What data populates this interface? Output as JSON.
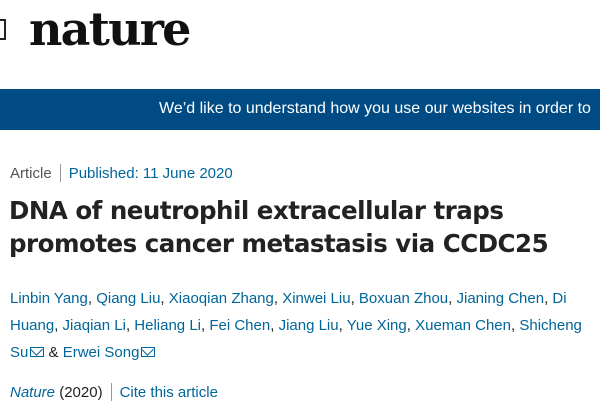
{
  "header": {
    "logo_text": "nature"
  },
  "banner": {
    "text": "We’d like to understand how you use our websites in order to"
  },
  "article": {
    "type": "Article",
    "published": "Published: 11 June 2020",
    "title": "DNA of neutrophil extracellular traps promotes cancer metastasis via CCDC25",
    "authors": [
      "Linbin Yang",
      "Qiang Liu",
      "Xiaoqian Zhang",
      "Xinwei Liu",
      "Boxuan Zhou",
      "Jianing Chen",
      "Di Huang",
      "Jiaqian Li",
      "Heliang Li",
      "Fei Chen",
      "Jiang Liu",
      "Yue Xing",
      "Xueman Chen",
      "Shicheng Su",
      "Erwei Song"
    ],
    "amp": "&",
    "journal": "Nature",
    "year": "(2020)",
    "cite_label": "Cite this article"
  },
  "colors": {
    "banner_bg": "#004b83",
    "link": "#006699"
  },
  "icons": [
    "mail-icon"
  ]
}
